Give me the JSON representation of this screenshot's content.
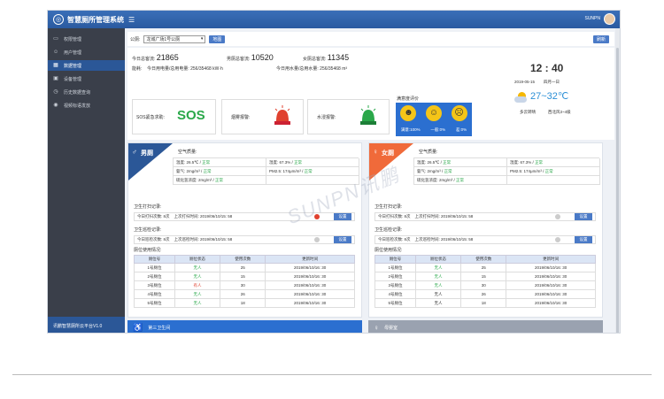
{
  "app": {
    "title": "智慧厕所管理系统",
    "user": "SUNPN"
  },
  "sidebar": {
    "items": [
      {
        "icon": "monitor-icon",
        "label": "权限管理"
      },
      {
        "icon": "users-icon",
        "label": "用户管理"
      },
      {
        "icon": "data-icon",
        "label": "数据管理"
      },
      {
        "icon": "device-icon",
        "label": "设备管理"
      },
      {
        "icon": "history-icon",
        "label": "历史数据查询"
      },
      {
        "icon": "broadcast-icon",
        "label": "视频标语发放"
      }
    ],
    "active": 2,
    "footer": "讯鹏智慧厕所云平台V1.0"
  },
  "filter": {
    "label": "公厕:",
    "selected": "龙城广场1号公厕",
    "map_btn": "地图",
    "refresh_btn": "刷新"
  },
  "stats": {
    "today_total_label": "今日总客流:",
    "today_total": "21865",
    "male_label": "男厕总客流:",
    "male": "10520",
    "female_label": "女厕总客流:",
    "female": "11345",
    "energy_label": "能耗:",
    "power_label": "今日用电量/总用电量:",
    "power": "256/35468",
    "power_unit": "kW·h",
    "water_label": "今日用水量/总用水量:",
    "water": "256/35468",
    "water_unit": "m³"
  },
  "alarms": {
    "sos_label": "SOS紧急求助:",
    "sos": "SOS",
    "smoke_label": "烟雾报警:",
    "water_label": "水浸报警:"
  },
  "satisfaction": {
    "label": "满意度评价",
    "items": [
      {
        "label": "满意:",
        "value": "100%"
      },
      {
        "label": "一般:",
        "value": "0%"
      },
      {
        "label": "差:",
        "value": "0%"
      }
    ]
  },
  "time": {
    "clock": "12 : 40",
    "date": "2019-05-15",
    "weekday": "四月一日",
    "temp": "27~32℃",
    "weather": "多云转晴",
    "wind": "西北风3~4级"
  },
  "male": {
    "title": "男厕",
    "air_label": "空气质量:",
    "env": [
      {
        "k": "温度:",
        "v": "26.5℃ /",
        "s": "正常"
      },
      {
        "k": "湿度:",
        "v": "67.3% /",
        "s": "正常"
      },
      {
        "k": "氨气:",
        "v": "2mg/m³ /",
        "s": "正常"
      },
      {
        "k": "PM2.5:",
        "v": "174μm/m³ /",
        "s": "正常"
      },
      {
        "k": "硫化氢浓度:",
        "v": "2mg/m³ /",
        "s": "正常"
      }
    ],
    "clean_label": "卫生打扫记录:",
    "clean_count": "今日打扫次数:  8次",
    "clean_last": "上次打扫时间:  2019/06/10/15:  58",
    "patrol_label": "卫生巡检记录:",
    "patrol_count": "今日巡检次数:  8次",
    "patrol_last": "上次巡检时间:  2019/06/10/15:  58",
    "set_btn": "设置",
    "stall_label": "厕位使用情况:",
    "headers": [
      "厕位号",
      "厕位状态",
      "使用次数",
      "更新时间"
    ],
    "rows": [
      [
        "1号厕位",
        "无人",
        "25",
        "2019/06/10/16:  30"
      ],
      [
        "2号厕位",
        "无人",
        "15",
        "2019/06/10/16:  30"
      ],
      [
        "3号厕位",
        "有人",
        "30",
        "2019/06/10/16:  30"
      ],
      [
        "4号厕位",
        "无人",
        "26",
        "2019/06/10/16:  30"
      ],
      [
        "5号厕位",
        "无人",
        "18",
        "2019/06/10/16:  30"
      ]
    ]
  },
  "female": {
    "title": "女厕",
    "air_label": "空气质量:",
    "env": [
      {
        "k": "温度:",
        "v": "26.5℃ /",
        "s": "正常"
      },
      {
        "k": "湿度:",
        "v": "67.3% /",
        "s": "正常"
      },
      {
        "k": "氨气:",
        "v": "2mg/m³ /",
        "s": "正常"
      },
      {
        "k": "PM2.5:",
        "v": "174μm/m³ /",
        "s": "正常"
      },
      {
        "k": "硫化氢浓度:",
        "v": "2mg/m³ /",
        "s": "正常"
      }
    ],
    "clean_label": "卫生打扫记录:",
    "clean_count": "今日打扫次数:  8次",
    "clean_last": "上次打扫时间:  2019/06/10/15:  58",
    "patrol_label": "卫生巡检记录:",
    "patrol_count": "今日巡检次数:  8次",
    "patrol_last": "上次巡检时间:  2019/06/10/15:  58",
    "set_btn": "设置",
    "stall_label": "厕位使用情况:",
    "headers": [
      "厕位号",
      "厕位状态",
      "使用次数",
      "更新时间"
    ],
    "rows": [
      [
        "1号厕位",
        "无人",
        "25",
        "2019/06/10/16:  30"
      ],
      [
        "2号厕位",
        "无人",
        "15",
        "2019/06/10/16:  30"
      ],
      [
        "3号厕位",
        "无人",
        "30",
        "2019/06/10/16:  30"
      ],
      [
        "4号厕位",
        "无人",
        "26",
        "2019/06/10/16:  30"
      ],
      [
        "5号厕位",
        "无人",
        "18",
        "2019/06/10/16:  30"
      ]
    ]
  },
  "bottom": {
    "left": "第三卫生间",
    "right": "母婴室"
  },
  "watermark": "SUNPN讯鹏",
  "colors": {
    "blue": "#2b5797",
    "orange": "#f06a3a",
    "green": "#2aa84a",
    "red": "#e0412f"
  }
}
